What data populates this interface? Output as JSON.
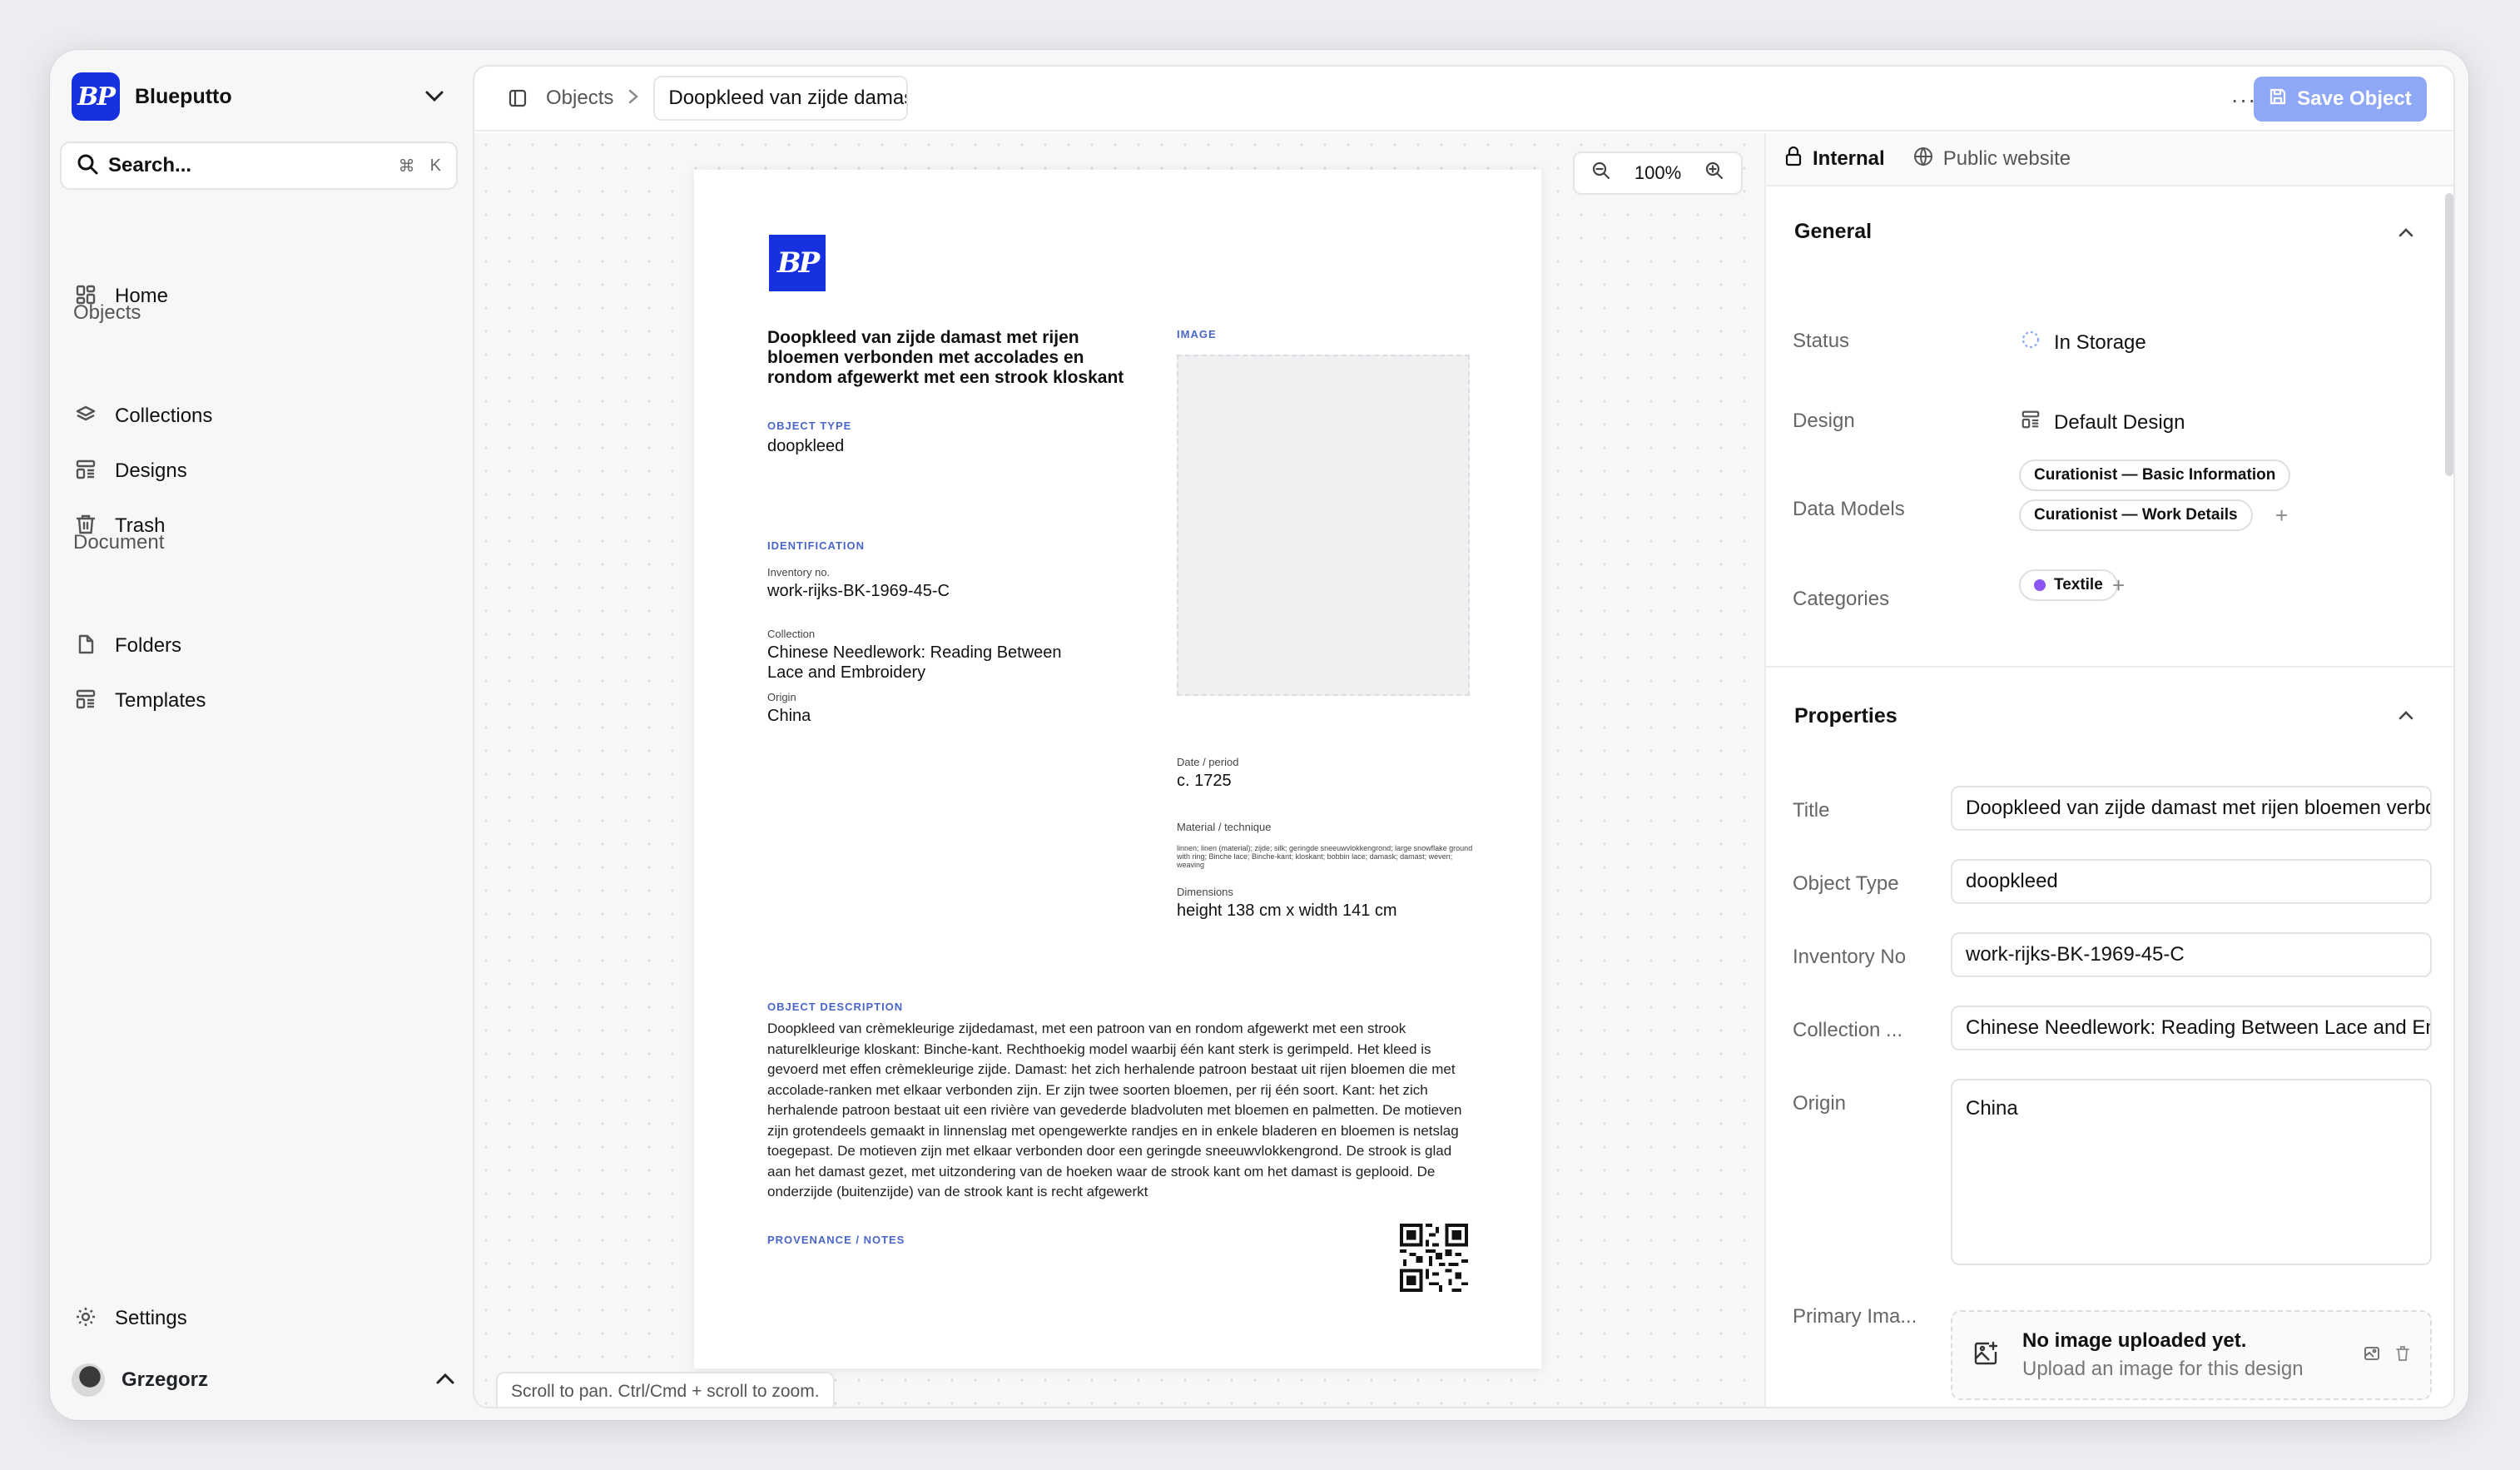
{
  "app": {
    "name": "Blueputto",
    "logo_text": "BP"
  },
  "search": {
    "label": "Search...",
    "shortcut_mod": "⌘",
    "shortcut_key": "K"
  },
  "sidebar": {
    "home": "Home",
    "objects_section": "Objects",
    "collections": "Collections",
    "designs": "Designs",
    "trash": "Trash",
    "document_section": "Document",
    "folders": "Folders",
    "templates": "Templates",
    "settings": "Settings",
    "user": "Grzegorz"
  },
  "topbar": {
    "crumb_objects": "Objects",
    "crumb_separator": ">",
    "crumb_current": "Doopkleed van zijde damast met rijen bloemen",
    "more": "···",
    "save_label": "Save Object"
  },
  "canvas": {
    "zoom_level": "100%",
    "hint": "Scroll to pan. Ctrl/Cmd + scroll to zoom."
  },
  "sheet": {
    "title": "Doopkleed van zijde damast met rijen bloemen verbonden met accolades en rondom afgewerkt met een strook kloskant",
    "image_caption": "IMAGE",
    "object_type_caption": "OBJECT TYPE",
    "object_type": "doopkleed",
    "identification_caption": "IDENTIFICATION",
    "inventory_label": "Inventory no.",
    "inventory_value": "work-rijks-BK-1969-45-C",
    "collection_label": "Collection",
    "collection_value": "Chinese Needlework: Reading Between Lace and Embroidery",
    "origin_label": "Origin",
    "origin_value": "China",
    "date_label": "Date / period",
    "date_value": "c. 1725",
    "material_label": "Material / technique",
    "material_value": "linnen; linen (material); zijde; silk; geringde sneeuwvlokkengrond; large snowflake ground with ring; Binche lace; Binche-kant; kloskant; bobbin lace; damask; damast; weven; weaving",
    "dimensions_label": "Dimensions",
    "dimensions_value": "height 138 cm x width 141 cm",
    "description_caption": "OBJECT DESCRIPTION",
    "description": "Doopkleed van crèmekleurige zijdedamast, met een patroon van en rondom afgewerkt met een strook naturelkleurige kloskant: Binche-kant. Rechthoekig model waarbij één kant sterk is gerimpeld. Het kleed is gevoerd met effen crèmekleurige zijde. Damast: het zich herhalende patroon bestaat uit rijen bloemen die met accolade-ranken met elkaar verbonden zijn. Er zijn twee soorten bloemen, per rij één soort. Kant: het zich herhalende patroon bestaat uit een rivière van gevederde bladvoluten met bloemen en palmetten. De motieven zijn grotendeels gemaakt in linnenslag met opengewerkte randjes en in enkele bladeren en bloemen is netslag toegepast. De motieven zijn met elkaar verbonden door een geringde sneeuwvlokkengrond. De strook is glad aan het damast gezet, met uitzondering van de hoeken waar de strook kant om het damast is geplooid. De onderzijde (buitenzijde) van de strook kant is recht afgewerkt",
    "provenance_caption": "PROVENANCE / NOTES"
  },
  "panel": {
    "tab_internal": "Internal",
    "tab_public": "Public website",
    "general_title": "General",
    "status_label": "Status",
    "status_value": "In Storage",
    "design_label": "Design",
    "design_value": "Default Design",
    "data_models_label": "Data Models",
    "data_models": [
      "Curationist — Basic Information",
      "Curationist — Work Details"
    ],
    "categories_label": "Categories",
    "category": "Textile",
    "category_color": "#8a55f0",
    "add": "+",
    "properties_title": "Properties",
    "title_label": "Title",
    "title_value": "Doopkleed van zijde damast met rijen bloemen verbonden",
    "object_type_label": "Object Type",
    "object_type_value": "doopkleed",
    "inventory_label": "Inventory No",
    "inventory_value": "work-rijks-BK-1969-45-C",
    "collection_label": "Collection ...",
    "collection_value": "Chinese Needlework: Reading Between Lace and Embroidery",
    "origin_label": "Origin",
    "origin_value": "China",
    "primary_image_label": "Primary Ima...",
    "upload_title": "No image uploaded yet.",
    "upload_sub": "Upload an image for this design"
  },
  "colors": {
    "brand": "#1730e0",
    "save_button": "#8fa8f5",
    "caption_blue": "#4a66c8"
  }
}
